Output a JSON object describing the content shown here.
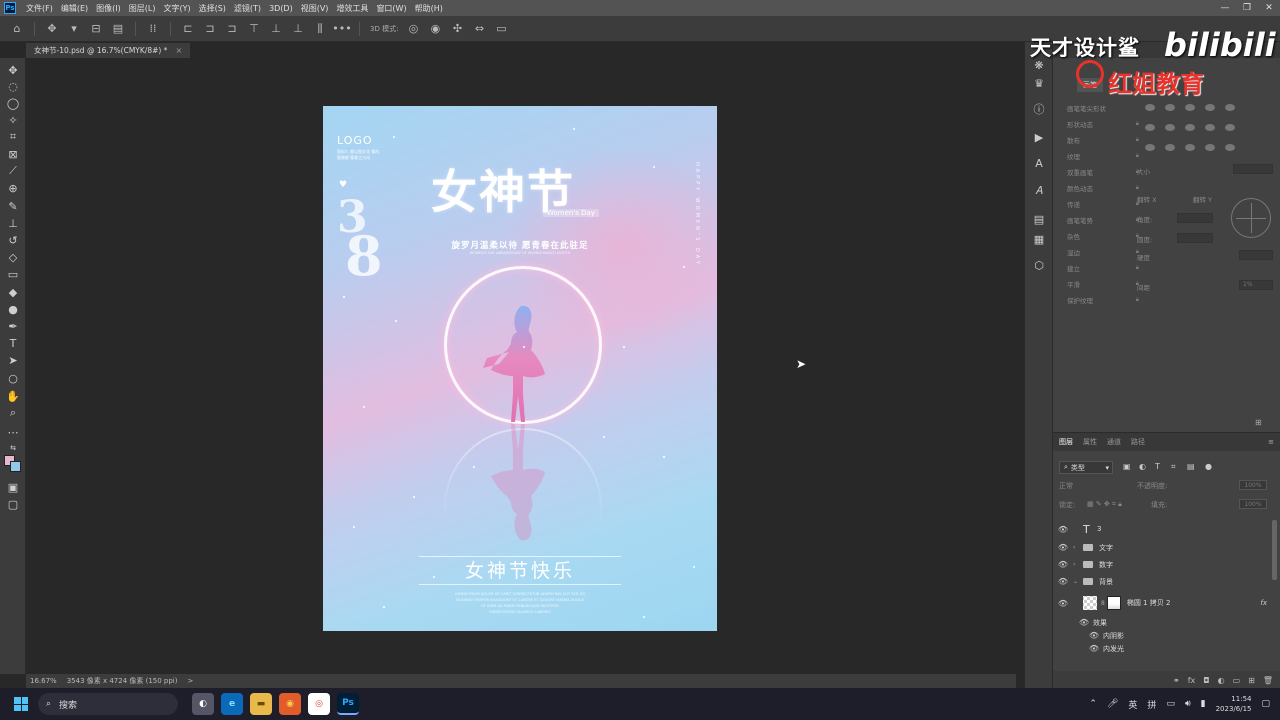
{
  "menubar": {
    "items": [
      "文件(F)",
      "编辑(E)",
      "图像(I)",
      "图层(L)",
      "文字(Y)",
      "选择(S)",
      "滤镜(T)",
      "3D(D)",
      "视图(V)",
      "增效工具",
      "窗口(W)",
      "帮助(H)"
    ]
  },
  "options": {
    "mode_label": "3D 模式:"
  },
  "document_tab": {
    "title": "女神节-10.psd @ 16.7%(CMYK/8#) *",
    "close": "×"
  },
  "poster": {
    "logo": "LOGO",
    "small_text": "国际/I, 都以图文化 都的健康都 都都立方向",
    "num_3": "3",
    "num_8": "8",
    "title": "女神节",
    "womens_day": "Women's Day",
    "subtitle": "旋罗月温柔以待 愿青春在此驻足",
    "subtitle_small": "WOMEN'S DAY ANNIVERSARY OF WOMEN MARCH EIGHTH",
    "vertical_text": "HAPPY WOMEN'S DAY",
    "bottom_title": "女神节快乐",
    "bottom_lines": [
      "LOREM IPSUM DOLOR SIT AMET CONSECTETUR ADIPISCING ELIT SED DO",
      "EIUSMOD TEMPOR INCIDIDUNT UT LABORE ET DOLORE MAGNA ALIQUA",
      "UT ENIM AD MINIM VENIAM QUIS NOSTRUD",
      "EXERCITATION ULLAMCO LABORIS"
    ]
  },
  "status": {
    "zoom": "16.67%",
    "doc_size": "3543 像素 x 4724 像素 (150 ppi)",
    "arrow": ">"
  },
  "watermark": {
    "name": "天才设计鲨",
    "bili": "bilibili",
    "brand": "红姐教育"
  },
  "brush_panel": {
    "tab": "画笔",
    "list": [
      "画笔笔尖形状",
      "形状动态",
      "散布",
      "纹理",
      "双重画笔",
      "颜色动态",
      "传递",
      "画笔笔势",
      "杂色",
      "湿边",
      "建立",
      "平滑",
      "保护纹理"
    ],
    "size_label": "大小",
    "flip_x": "翻转 X",
    "flip_y": "翻转 Y",
    "angle": "角度:",
    "roundness": "圆度:",
    "hardness": "硬度",
    "spacing": "间距",
    "spacing_value": "1%"
  },
  "layers_panel": {
    "tabs": [
      "图层",
      "属性",
      "通道",
      "路径"
    ],
    "filter": "类型",
    "blend_mode": "正常",
    "opacity_label": "不透明度:",
    "opacity_value": "100%",
    "lock_label": "锁定:",
    "fill_label": "填充:",
    "fill_value": "100%",
    "layers": [
      {
        "name": "3",
        "kind": "text"
      },
      {
        "name": "文字",
        "kind": "folder"
      },
      {
        "name": "数字",
        "kind": "folder"
      },
      {
        "name": "背景",
        "kind": "folder-open"
      },
      {
        "name": "椭圆 1 拷贝 2",
        "kind": "shape",
        "fx": "fx"
      },
      {
        "name": "效果",
        "kind": "effects"
      },
      {
        "name": "内阴影",
        "kind": "effect"
      },
      {
        "name": "内发光",
        "kind": "effect"
      }
    ]
  },
  "taskbar": {
    "search_placeholder": "搜索",
    "ime_lang": "英",
    "ime_mode": "拼",
    "time": "11:54",
    "date": "2023/6/15"
  }
}
